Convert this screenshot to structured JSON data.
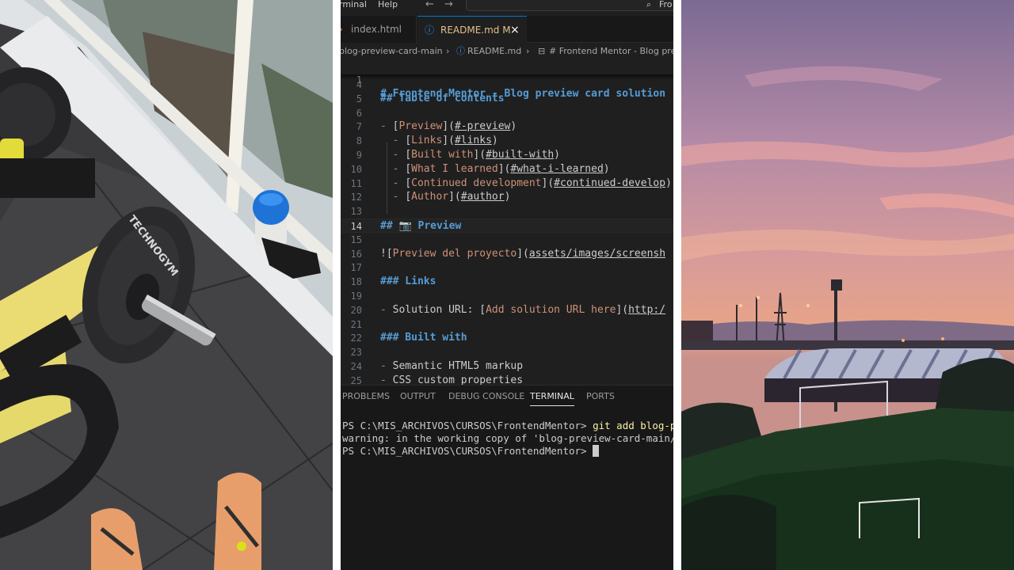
{
  "menu": {
    "items": [
      "rminal",
      "Help"
    ],
    "search_text": "Fro"
  },
  "tabs": [
    {
      "label": "index.html",
      "active": false
    },
    {
      "label": "README.md",
      "status": "M",
      "active": true
    }
  ],
  "breadcrumb": [
    "blog-preview-card-main",
    "README.md",
    "# Frontend Mentor - Blog pre"
  ],
  "sticky_line": {
    "number": "1",
    "text": "# Frontend Mentor - Blog preview card solution"
  },
  "editor_lines": [
    {
      "n": "4",
      "text": ""
    },
    {
      "n": "5",
      "text": "## Table of contents"
    },
    {
      "n": "6",
      "text": ""
    },
    {
      "n": "7",
      "indent": "",
      "label": "Preview",
      "target": "#-preview"
    },
    {
      "n": "8",
      "indent": "  ",
      "label": "Links",
      "target": "#links"
    },
    {
      "n": "9",
      "indent": "  ",
      "label": "Built with",
      "target": "#built-with"
    },
    {
      "n": "10",
      "indent": "  ",
      "label": "What I learned",
      "target": "#what-i-learned"
    },
    {
      "n": "11",
      "indent": "  ",
      "label": "Continued development",
      "target": "#continued-develop"
    },
    {
      "n": "12",
      "indent": "  ",
      "label": "Author",
      "target": "#author"
    },
    {
      "n": "13",
      "text": ""
    },
    {
      "n": "14",
      "text": "## 📷 Preview"
    },
    {
      "n": "15",
      "text": ""
    },
    {
      "n": "16",
      "image_alt": "Preview del proyecto",
      "image_src": "assets/images/screensh"
    },
    {
      "n": "17",
      "text": ""
    },
    {
      "n": "18",
      "text": "### Links"
    },
    {
      "n": "19",
      "text": ""
    },
    {
      "n": "20",
      "prefix": "Solution URL: ",
      "label": "Add solution URL here",
      "target": "http:/"
    },
    {
      "n": "21",
      "text": ""
    },
    {
      "n": "22",
      "text": "### Built with"
    },
    {
      "n": "23",
      "text": ""
    },
    {
      "n": "24",
      "bullet": "Semantic HTML5 markup"
    },
    {
      "n": "25",
      "bullet": "CSS custom properties"
    }
  ],
  "panel_tabs": [
    "PROBLEMS",
    "OUTPUT",
    "DEBUG CONSOLE",
    "TERMINAL",
    "PORTS"
  ],
  "active_panel_tab": "TERMINAL",
  "terminal": {
    "line1_prompt": "PS C:\\MIS_ARCHIVOS\\CURSOS\\FrontendMentor> ",
    "line1_cmd": "git add blog-p",
    "line2": "warning: in the working copy of 'blog-preview-card-main/",
    "line3_prompt": "PS C:\\MIS_ARCHIVOS\\CURSOS\\FrontendMentor> "
  },
  "photos": {
    "plate_text": "TECHNOGYM"
  }
}
